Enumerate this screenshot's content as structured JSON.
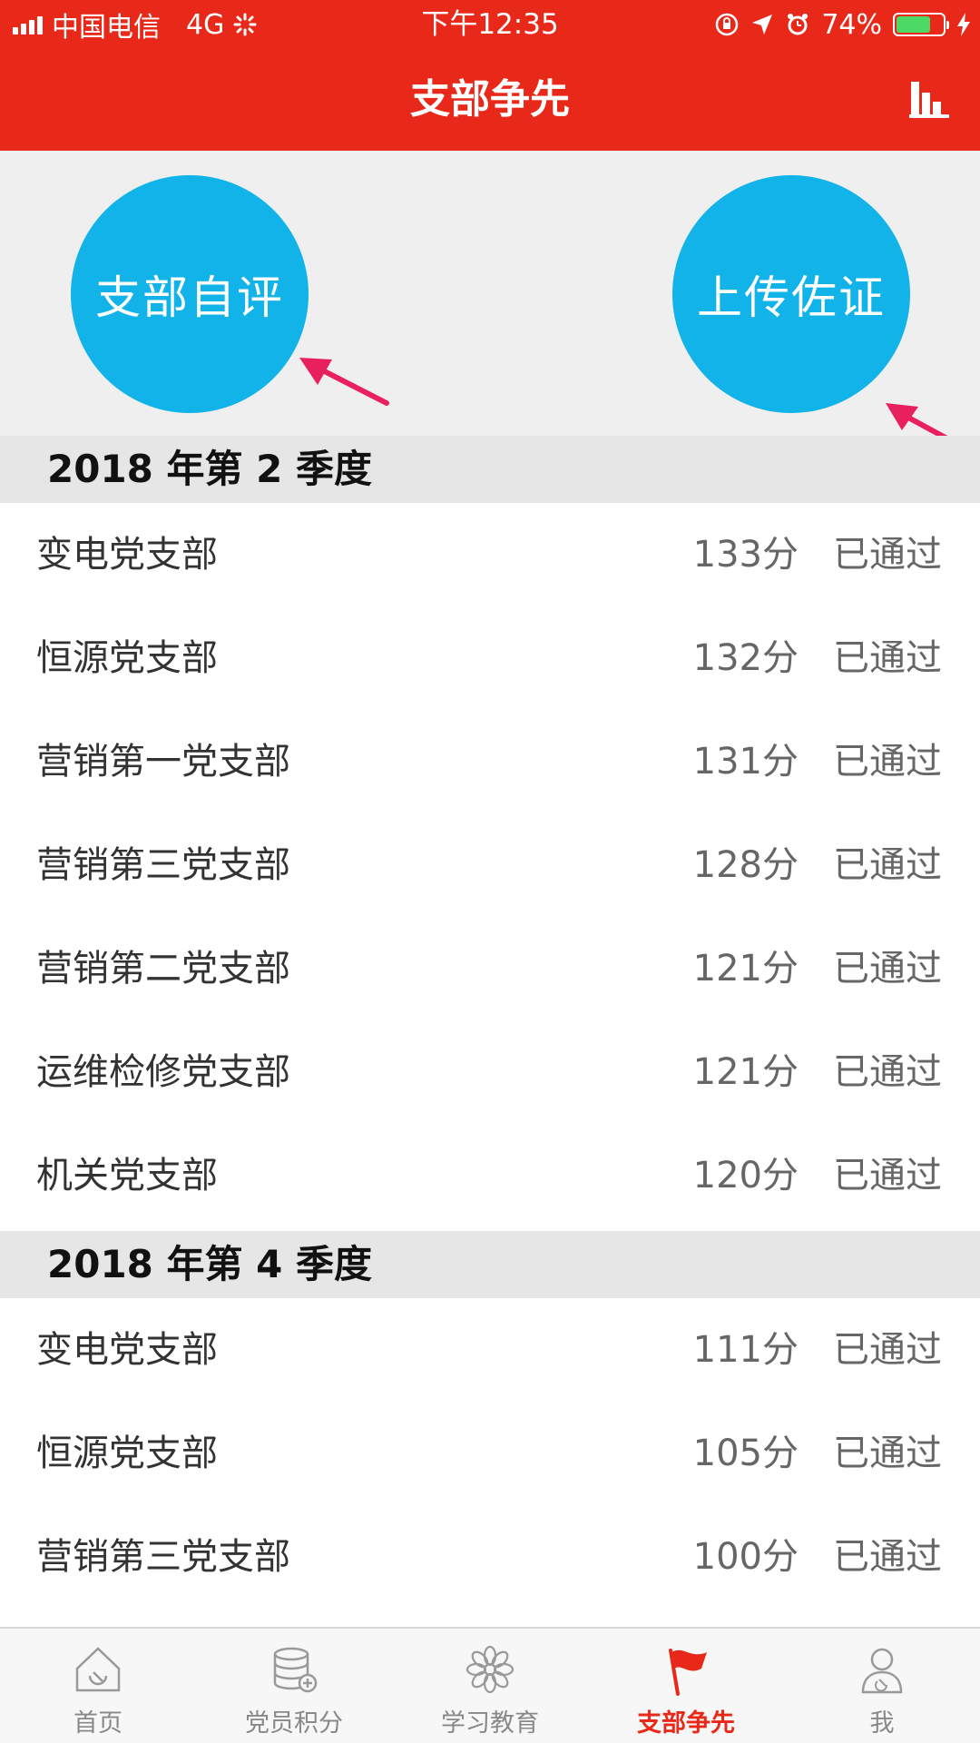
{
  "status_bar": {
    "carrier": "中国电信",
    "network": "4G",
    "time": "下午12:35",
    "battery": "74%",
    "battery_level": 0.74
  },
  "header": {
    "title": "支部争先"
  },
  "actions": {
    "self_review": "支部自评",
    "upload_evidence": "上传佐证"
  },
  "sections": [
    {
      "title": "2018 年第 2 季度",
      "rows": [
        {
          "name": "变电党支部",
          "score": "133分",
          "status": "已通过"
        },
        {
          "name": "恒源党支部",
          "score": "132分",
          "status": "已通过"
        },
        {
          "name": "营销第一党支部",
          "score": "131分",
          "status": "已通过"
        },
        {
          "name": "营销第三党支部",
          "score": "128分",
          "status": "已通过"
        },
        {
          "name": "营销第二党支部",
          "score": "121分",
          "status": "已通过"
        },
        {
          "name": "运维检修党支部",
          "score": "121分",
          "status": "已通过"
        },
        {
          "name": "机关党支部",
          "score": "120分",
          "status": "已通过"
        }
      ]
    },
    {
      "title": "2018 年第 4 季度",
      "rows": [
        {
          "name": "变电党支部",
          "score": "111分",
          "status": "已通过"
        },
        {
          "name": "恒源党支部",
          "score": "105分",
          "status": "已通过"
        },
        {
          "name": "营销第三党支部",
          "score": "100分",
          "status": "已通过"
        }
      ]
    }
  ],
  "tabbar": {
    "items": [
      {
        "label": "首页",
        "icon": "home-icon"
      },
      {
        "label": "党员积分",
        "icon": "coins-icon"
      },
      {
        "label": "学习教育",
        "icon": "flower-icon"
      },
      {
        "label": "支部争先",
        "icon": "flag-icon"
      },
      {
        "label": "我",
        "icon": "user-icon"
      }
    ],
    "active_index": 3
  },
  "colors": {
    "brand_red": "#e8291a",
    "button_blue": "#11b3e9",
    "arrow_pink": "#e8215e"
  }
}
